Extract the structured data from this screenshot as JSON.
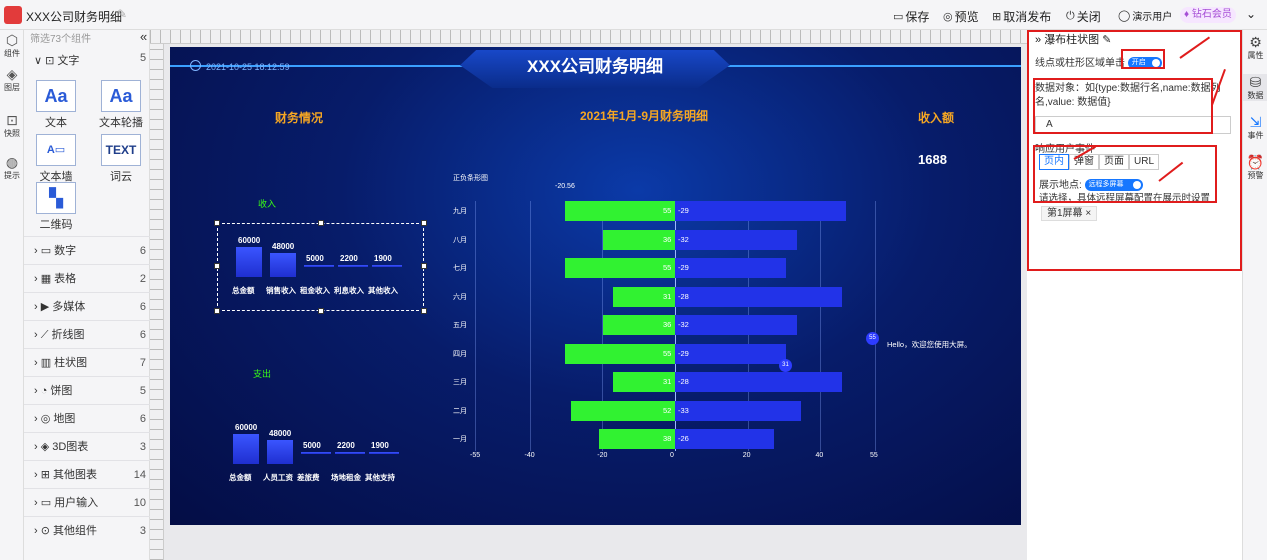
{
  "app": {
    "title": "XXX公司财务明细",
    "toolbar": {
      "save": "保存",
      "preview": "预览",
      "unpublish": "取消发布",
      "close": "关闭",
      "user": "演示用户",
      "vip": "钻石会员"
    }
  },
  "left_rail": [
    {
      "label": "组件",
      "icon": "component-icon"
    },
    {
      "label": "图层",
      "icon": "layers-icon"
    },
    {
      "label": "快照",
      "icon": "snapshot-icon"
    },
    {
      "label": "提示",
      "icon": "tip-icon"
    }
  ],
  "component_panel": {
    "search_placeholder": "筛选73个组件",
    "collapse": "«",
    "text_section": "文字",
    "text_count": "5",
    "tiles": [
      "文本",
      "文本轮播",
      "文本墙",
      "词云",
      "二维码"
    ],
    "categories": [
      {
        "label": "数字",
        "count": "6"
      },
      {
        "label": "表格",
        "count": "2"
      },
      {
        "label": "多媒体",
        "count": "6"
      },
      {
        "label": "折线图",
        "count": "6"
      },
      {
        "label": "柱状图",
        "count": "7"
      },
      {
        "label": "饼图",
        "count": "5"
      },
      {
        "label": "地图",
        "count": "6"
      },
      {
        "label": "3D图表",
        "count": "3"
      },
      {
        "label": "其他图表",
        "count": "14"
      },
      {
        "label": "用户输入",
        "count": "10"
      },
      {
        "label": "其他组件",
        "count": "3"
      }
    ]
  },
  "dashboard": {
    "title": "XXX公司财务明细",
    "date": "2021-10-25 18:12:59",
    "finance_title": "财务情况",
    "center_title": "2021年1月-9月财务明细",
    "income_title": "收入额",
    "income_value": "1688",
    "income_label": "收入",
    "expense_label": "支出",
    "chart_label": "正负条形图",
    "hello_text": "Hello，欢迎您使用大屏。",
    "top_marker": "-20.56",
    "tooltip_value": "55",
    "tooltip_value2": "31"
  },
  "chart_data": [
    {
      "type": "bar",
      "title": "收入",
      "categories": [
        "总金额",
        "销售收入",
        "租金收入",
        "利息收入",
        "其他收入"
      ],
      "values": [
        60000,
        48000,
        5000,
        2200,
        1900
      ]
    },
    {
      "type": "bar",
      "title": "支出",
      "categories": [
        "总金额",
        "人员工资",
        "差旅费",
        "场地租金",
        "其他支持"
      ],
      "values": [
        60000,
        48000,
        5000,
        2200,
        1900
      ]
    },
    {
      "type": "bar",
      "title": "正负条形图",
      "orientation": "horizontal",
      "categories": [
        "九月",
        "八月",
        "七月",
        "六月",
        "五月",
        "四月",
        "三月",
        "二月",
        "一月"
      ],
      "series": [
        {
          "values": [
            55,
            36,
            55,
            31,
            36,
            55,
            31,
            52,
            38
          ],
          "color": "#31f231"
        },
        {
          "values": [
            -29,
            -32,
            -29,
            -28,
            -32,
            -29,
            -28,
            -33,
            -26
          ],
          "color": "#2233e8"
        }
      ],
      "x_ticks": [
        "-55",
        "-40",
        "-20",
        "0",
        "20",
        "40",
        "55"
      ],
      "xlim": [
        -55,
        55
      ]
    }
  ],
  "right_panel": {
    "header": "瀑布柱状图",
    "single_click_label": "线点或柱形区域单击",
    "toggle_on": "开启",
    "data_object_note": "数据对象：如{type:数据行名,name:数据列名,value: 数据值}",
    "input_value": "A",
    "response_event": "响应用户事件",
    "tabs": [
      "页内",
      "弹窗",
      "页面",
      "URL"
    ],
    "show_location": "展示地点:",
    "remote_toggle": "远程多屏幕",
    "hint": "请选择，具体远程屏幕配置在展示时设置",
    "screen_tag": "第1屏幕"
  },
  "right_rail": [
    "属性",
    "数据",
    "事件",
    "预警"
  ]
}
